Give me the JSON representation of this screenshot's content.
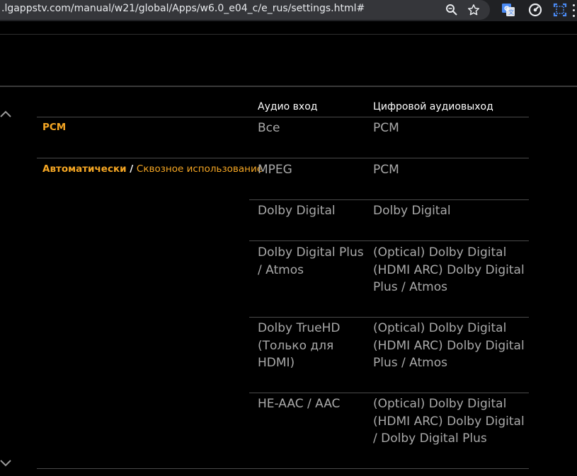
{
  "browser": {
    "url": ".lgappstv.com/manual/w21/global/Apps/w6.0_e04_c/e_rus/settings.html#",
    "icons": [
      "zoom-icon",
      "star-icon",
      "translate-extension-icon",
      "speed-extension-icon",
      "screenshot-extension-icon",
      "menu-icon"
    ]
  },
  "table": {
    "headers": {
      "audio_in": "Аудио вход",
      "digital_out": "Цифровой аудиовыход"
    },
    "modes": {
      "pcm": "PCM",
      "auto": "Автоматически",
      "separator": "/",
      "passthrough": "Сквозное использование"
    },
    "rows": [
      {
        "input": "Все",
        "output": "PCM"
      },
      {
        "input": "MPEG",
        "output": "PCM"
      },
      {
        "input": "Dolby Digital",
        "output": "Dolby Digital"
      },
      {
        "input": "Dolby Digital Plus / Atmos",
        "output": "(Optical) Dolby Digital (HDMI ARC) Dolby Digital Plus / Atmos"
      },
      {
        "input": "Dolby TrueHD (Только для HDMI)",
        "output": "(Optical) Dolby Digital (HDMI ARC) Dolby Digital Plus / Atmos"
      },
      {
        "input": "HE-AAC / AAC",
        "output": "(Optical) Dolby Digital (HDMI ARC) Dolby Digital / Dolby Digital Plus"
      }
    ]
  },
  "colors": {
    "background": "#000000",
    "mode_accent": "#f5a623",
    "cell_text": "#a9a9a9",
    "header_text": "#ffffff",
    "divider": "#4a4a4a"
  }
}
